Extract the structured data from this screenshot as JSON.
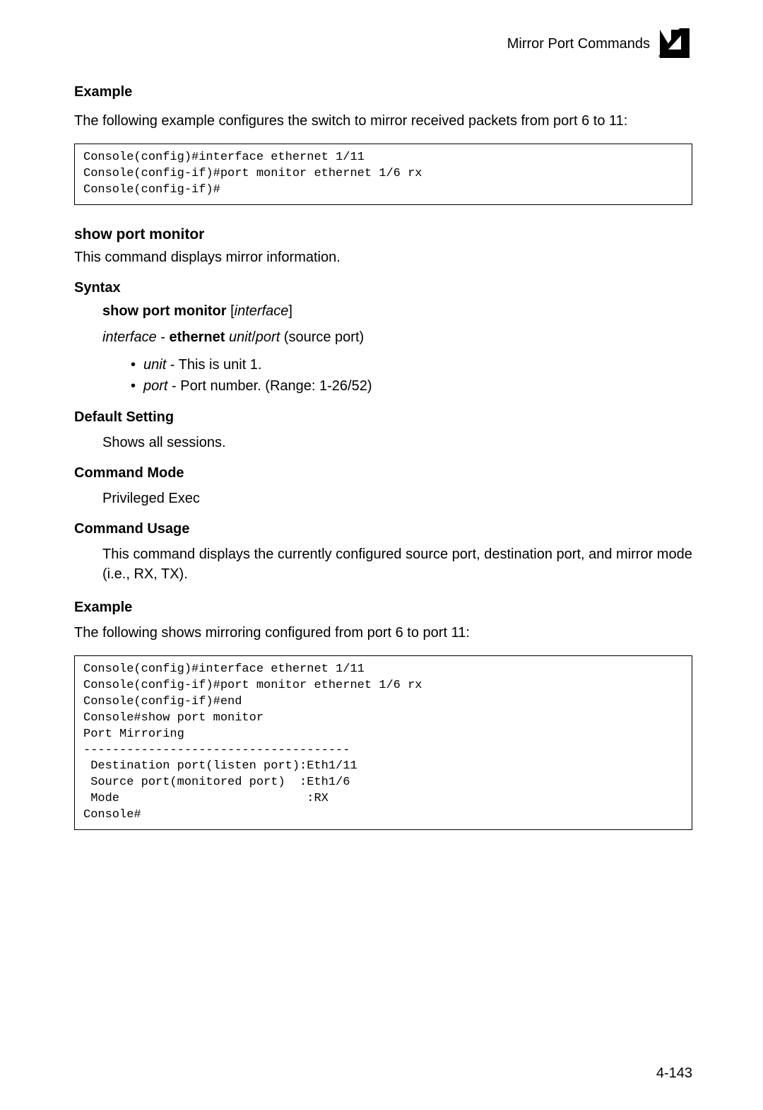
{
  "header": {
    "title": "Mirror Port Commands",
    "chapter": "4"
  },
  "example1": {
    "heading": "Example",
    "desc": "The following example configures the switch to mirror received packets from port 6 to 11:",
    "code": "Console(config)#interface ethernet 1/11\nConsole(config-if)#port monitor ethernet 1/6 rx\nConsole(config-if)#"
  },
  "command": {
    "name": "show port monitor",
    "desc": "This command displays mirror information."
  },
  "syntax": {
    "heading": "Syntax",
    "line_bold": "show port monitor",
    "line_bracket_open": " [",
    "line_italic": "interface",
    "line_bracket_close": "]",
    "line2_italic1": "interface",
    "line2_dash": " - ",
    "line2_bold": "ethernet",
    "line2_space": " ",
    "line2_italic2": "unit",
    "line2_slash": "/",
    "line2_italic3": "port",
    "line2_rest": " (source port)",
    "bullets": [
      {
        "italic": "unit",
        "rest": " - This is unit 1."
      },
      {
        "italic": "port",
        "rest": " - Port number. (Range: 1-26/52)"
      }
    ]
  },
  "default_setting": {
    "heading": "Default Setting",
    "text": "Shows all sessions."
  },
  "command_mode": {
    "heading": "Command Mode",
    "text": "Privileged Exec"
  },
  "command_usage": {
    "heading": "Command Usage",
    "text": "This command displays the currently configured source port, destination port, and mirror mode (i.e., RX, TX)."
  },
  "example2": {
    "heading": "Example",
    "desc": "The following shows mirroring configured from port 6 to port 11:",
    "code": "Console(config)#interface ethernet 1/11\nConsole(config-if)#port monitor ethernet 1/6 rx\nConsole(config-if)#end\nConsole#show port monitor\nPort Mirroring\n-------------------------------------\n Destination port(listen port):Eth1/11\n Source port(monitored port)  :Eth1/6\n Mode                          :RX\nConsole#"
  },
  "footer": {
    "page": "4-143"
  }
}
